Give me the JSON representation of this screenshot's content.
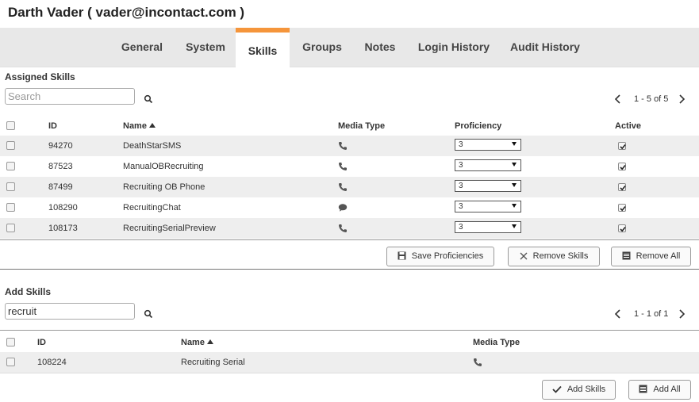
{
  "header": {
    "title": "Darth Vader ( vader@incontact.com )"
  },
  "tabs": [
    {
      "label": "General"
    },
    {
      "label": "System"
    },
    {
      "label": "Skills"
    },
    {
      "label": "Groups"
    },
    {
      "label": "Notes"
    },
    {
      "label": "Login History"
    },
    {
      "label": "Audit History"
    }
  ],
  "active_tab": "Skills",
  "colors": {
    "accent": "#f5953b",
    "tab_bar": "#e8e8e8",
    "row_shade": "#eeeeee"
  },
  "assigned": {
    "title": "Assigned Skills",
    "search_placeholder": "Search",
    "search_value": "",
    "pager": "1 - 5 of 5",
    "columns": {
      "id": "ID",
      "name": "Name",
      "media": "Media Type",
      "proficiency": "Proficiency",
      "active": "Active"
    },
    "rows": [
      {
        "id": "94270",
        "name": "DeathStarSMS",
        "media_icon": "phone-icon",
        "proficiency": "3",
        "active": true
      },
      {
        "id": "87523",
        "name": "ManualOBRecruiting",
        "media_icon": "phone-icon",
        "proficiency": "3",
        "active": true
      },
      {
        "id": "87499",
        "name": "Recruiting OB Phone",
        "media_icon": "phone-icon",
        "proficiency": "3",
        "active": true
      },
      {
        "id": "108290",
        "name": "RecruitingChat",
        "media_icon": "chat-icon",
        "proficiency": "3",
        "active": true
      },
      {
        "id": "108173",
        "name": "RecruitingSerialPreview",
        "media_icon": "phone-icon",
        "proficiency": "3",
        "active": true
      }
    ],
    "buttons": {
      "save": "Save Proficiencies",
      "remove": "Remove Skills",
      "remove_all": "Remove All"
    }
  },
  "add": {
    "title": "Add Skills",
    "search_value": "recruit",
    "pager": "1 - 1 of 1",
    "columns": {
      "id": "ID",
      "name": "Name",
      "media": "Media Type"
    },
    "rows": [
      {
        "id": "108224",
        "name": "Recruiting Serial",
        "media_icon": "phone-icon"
      }
    ],
    "buttons": {
      "add": "Add Skills",
      "add_all": "Add All"
    }
  }
}
